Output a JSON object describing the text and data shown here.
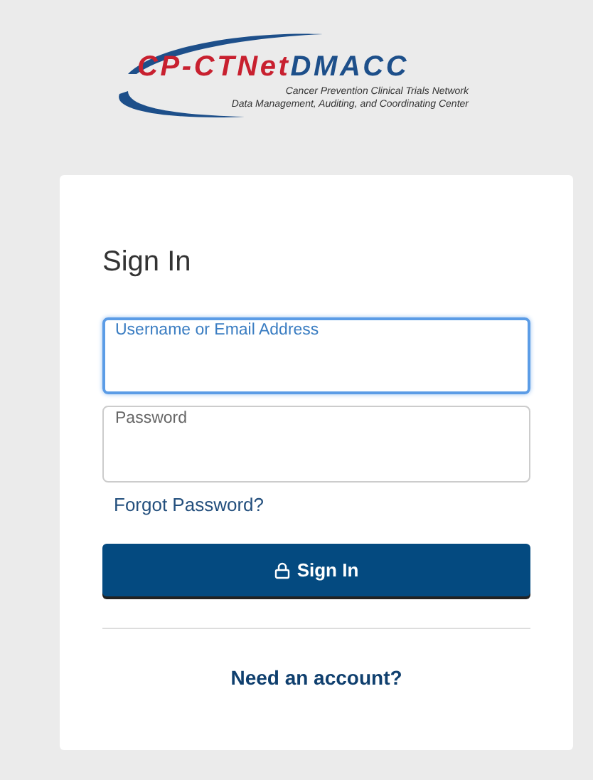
{
  "logo": {
    "parts": [
      {
        "text": "CP-CTNet",
        "color": "#c8202f"
      },
      {
        "text": "DMACC",
        "color": "#1d4f8a"
      }
    ],
    "subtitles": [
      "Cancer Prevention Clinical Trials Network",
      "Data Management, Auditing, and Coordinating Center"
    ]
  },
  "form": {
    "title": "Sign In",
    "fields": [
      {
        "label": "Username or Email Address",
        "focused": true
      },
      {
        "label": "Password",
        "focused": false
      }
    ],
    "forgot_link": "Forgot Password?",
    "submit": "Sign In",
    "register_link": "Need an account?"
  }
}
